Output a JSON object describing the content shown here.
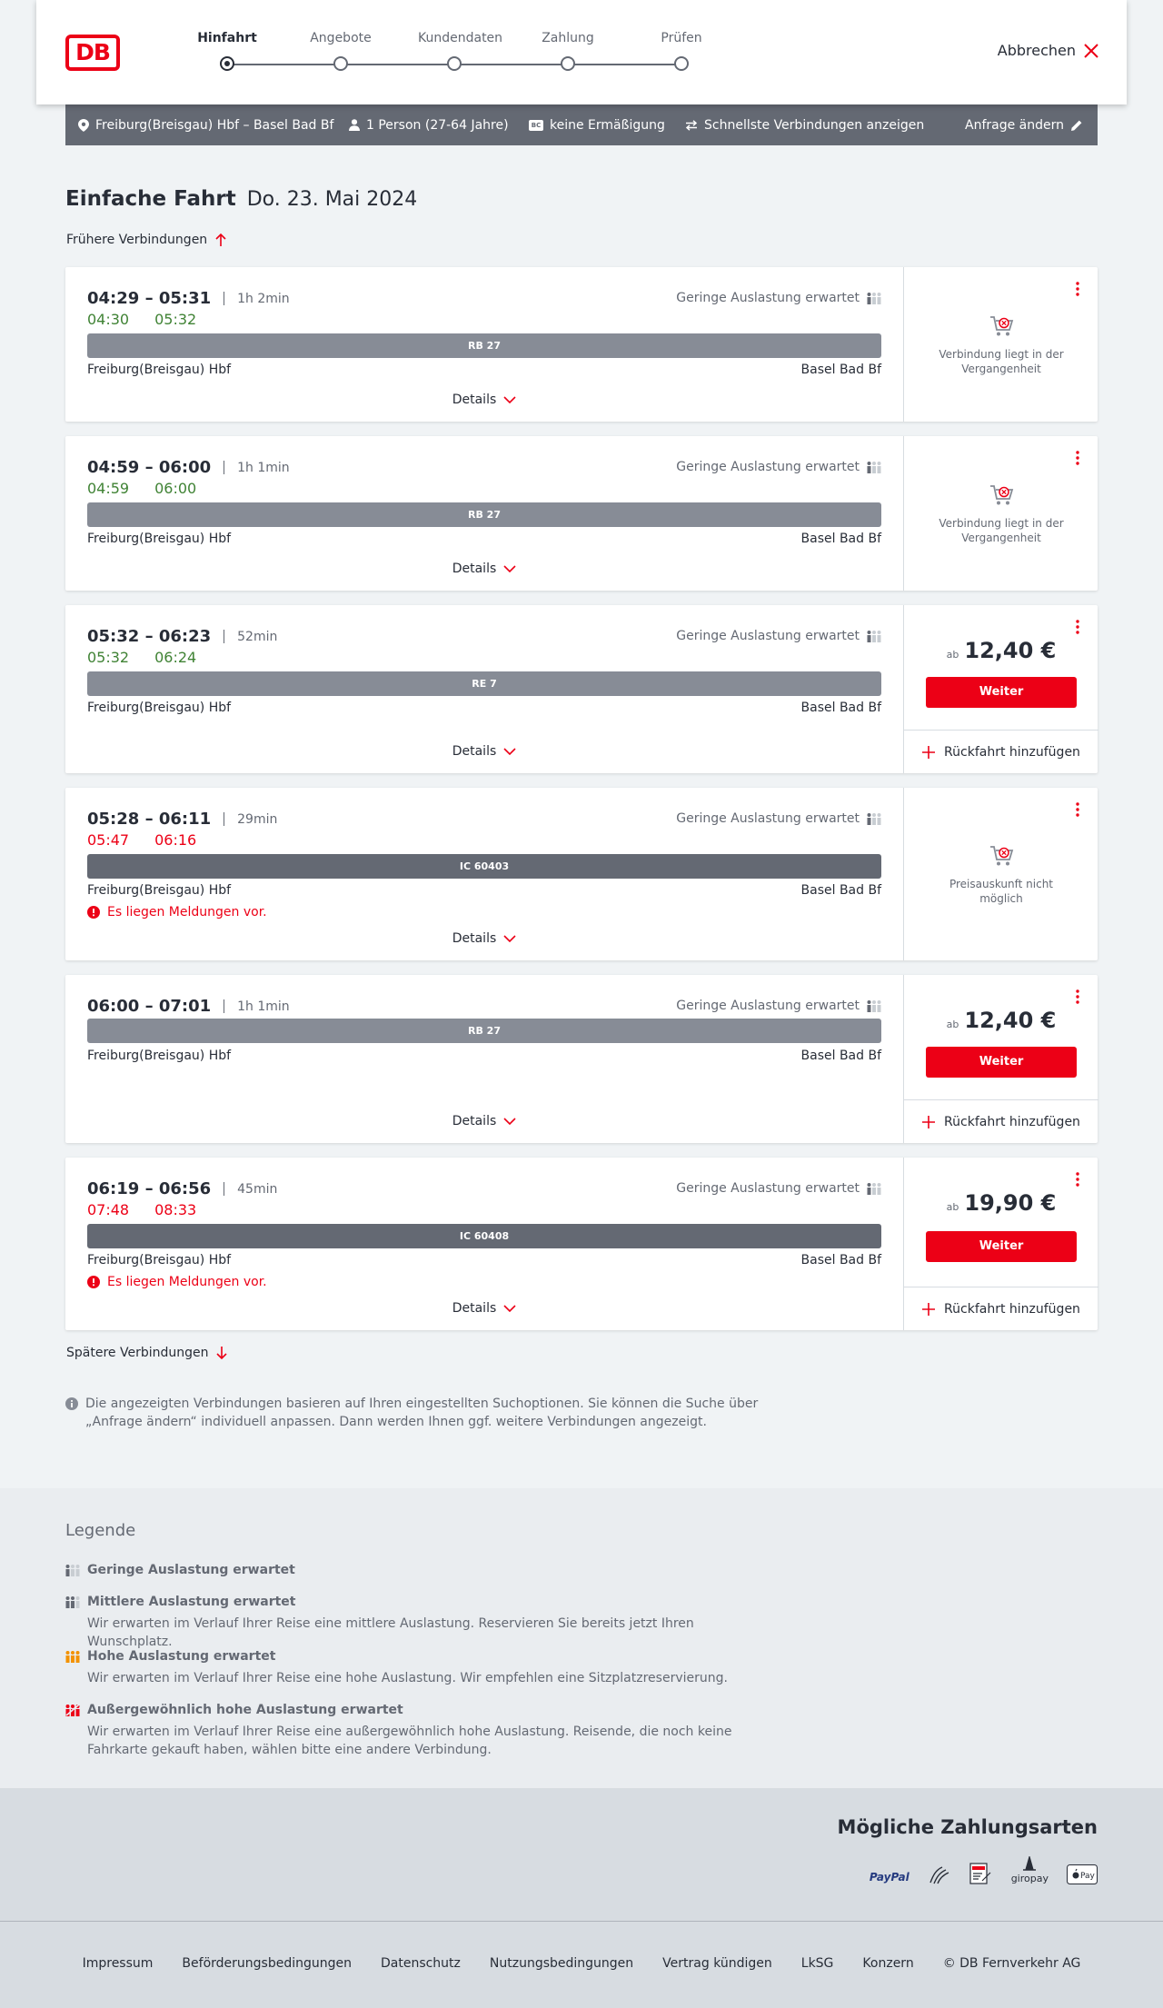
{
  "header": {
    "logo_text": "DB",
    "steps": [
      {
        "label": "Hinfahrt",
        "active": true
      },
      {
        "label": "Angebote",
        "active": false
      },
      {
        "label": "Kundendaten",
        "active": false
      },
      {
        "label": "Zahlung",
        "active": false
      },
      {
        "label": "Prüfen",
        "active": false
      }
    ],
    "cancel_label": "Abbrechen"
  },
  "request_bar": {
    "route": "Freiburg(Breisgau) Hbf – Basel Bad Bf",
    "passengers": "1 Person (27-64 Jahre)",
    "discount_badge": "BC",
    "discount": "keine Ermäßigung",
    "fastest": "Schnellste Verbindungen anzeigen",
    "change_request": "Anfrage ändern"
  },
  "main": {
    "title": "Einfache Fahrt",
    "date": "Do. 23. Mai 2024",
    "earlier_label": "Frühere Verbindungen",
    "later_label": "Spätere Verbindungen",
    "info_note": "Die angezeigten Verbindungen basieren auf Ihren eingestellten Suchoptionen. Sie können die Suche über „Anfrage ändern“ individuell anpassen. Dann werden Ihnen ggf. weitere Verbindungen angezeigt."
  },
  "connections": [
    {
      "times": "04:29 – 05:31",
      "duration": "1h 2min",
      "occupancy": "Geringe Auslastung erwartet",
      "realtime": {
        "dep": "04:30",
        "arr": "05:32",
        "status": "ok"
      },
      "train": "RB 27",
      "from": "Freiburg(Breisgau) Hbf",
      "to": "Basel Bad Bf",
      "details": "Details",
      "unavailable": "Verbindung liegt in der Vergangenheit"
    },
    {
      "times": "04:59 – 06:00",
      "duration": "1h 1min",
      "occupancy": "Geringe Auslastung erwartet",
      "realtime": {
        "dep": "04:59",
        "arr": "06:00",
        "status": "ok"
      },
      "train": "RB 27",
      "from": "Freiburg(Breisgau) Hbf",
      "to": "Basel Bad Bf",
      "details": "Details",
      "unavailable": "Verbindung liegt in der Vergangenheit"
    },
    {
      "times": "05:32 – 06:23",
      "duration": "52min",
      "occupancy": "Geringe Auslastung erwartet",
      "realtime": {
        "dep": "05:32",
        "arr": "06:24",
        "status": "ok"
      },
      "train": "RE 7",
      "from": "Freiburg(Breisgau) Hbf",
      "to": "Basel Bad Bf",
      "details": "Details",
      "price_prefix": "ab",
      "price": "12,40 €",
      "button": "Weiter",
      "return_label": "Rückfahrt hinzufügen"
    },
    {
      "times": "05:28 – 06:11",
      "duration": "29min",
      "occupancy": "Geringe Auslastung erwartet",
      "realtime": {
        "dep": "05:47",
        "arr": "06:16",
        "status": "late"
      },
      "train": "IC 60403",
      "from": "Freiburg(Breisgau) Hbf",
      "to": "Basel Bad Bf",
      "message": "Es liegen Meldungen vor.",
      "details": "Details",
      "unavailable": "Preisauskunft nicht möglich"
    },
    {
      "times": "06:00 – 07:01",
      "duration": "1h 1min",
      "occupancy": "Geringe Auslastung erwartet",
      "train": "RB 27",
      "from": "Freiburg(Breisgau) Hbf",
      "to": "Basel Bad Bf",
      "details": "Details",
      "price_prefix": "ab",
      "price": "12,40 €",
      "button": "Weiter",
      "return_label": "Rückfahrt hinzufügen"
    },
    {
      "times": "06:19 – 06:56",
      "duration": "45min",
      "occupancy": "Geringe Auslastung erwartet",
      "realtime": {
        "dep": "07:48",
        "arr": "08:33",
        "status": "late"
      },
      "train": "IC 60408",
      "from": "Freiburg(Breisgau) Hbf",
      "to": "Basel Bad Bf",
      "message": "Es liegen Meldungen vor.",
      "details": "Details",
      "price_prefix": "ab",
      "price": "19,90 €",
      "button": "Weiter",
      "return_label": "Rückfahrt hinzufügen"
    }
  ],
  "legend": {
    "title": "Legende",
    "items": [
      {
        "title": "Geringe Auslastung erwartet",
        "desc": "",
        "icon": "occupancy-low-icon"
      },
      {
        "title": "Mittlere Auslastung erwartet",
        "desc": "Wir erwarten im Verlauf Ihrer Reise eine mittlere Auslastung. Reservieren Sie bereits jetzt Ihren Wunschplatz.",
        "icon": "occupancy-medium-icon"
      },
      {
        "title": "Hohe Auslastung erwartet",
        "desc": "Wir erwarten im Verlauf Ihrer Reise eine hohe Auslastung. Wir empfehlen eine Sitzplatzreservierung.",
        "icon": "occupancy-high-icon"
      },
      {
        "title": "Außergewöhnlich hohe Auslastung erwartet",
        "desc": "Wir erwarten im Verlauf Ihrer Reise eine außergewöhnlich hohe Auslastung. Reisende, die noch keine Fahrkarte gekauft haben, wählen bitte eine andere Verbindung.",
        "icon": "occupancy-extreme-icon"
      }
    ]
  },
  "payment": {
    "title": "Mögliche Zahlungsarten",
    "methods": [
      "PayPal",
      "Kreditkarte",
      "SEPA",
      "giropay",
      "Apple Pay"
    ]
  },
  "footer": {
    "links": [
      "Impressum",
      "Beförderungsbedingungen",
      "Datenschutz",
      "Nutzungsbedingungen",
      "Vertrag kündigen",
      "LkSG",
      "Konzern",
      "© DB Fernverkehr AG"
    ]
  },
  "colors": {
    "brand_red": "#ec0016",
    "ontime_green": "#408335",
    "late_red": "#ec0016",
    "request_bar": "#646973"
  }
}
